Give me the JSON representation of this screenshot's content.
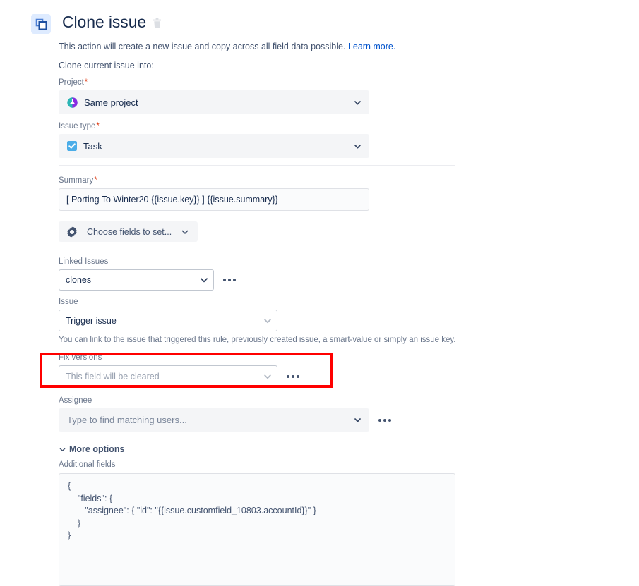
{
  "header": {
    "icon": "clone-issue-icon",
    "title": "Clone issue",
    "delete_icon": "trash-icon"
  },
  "description": {
    "text": "This action will create a new issue and copy across all field data possible.",
    "link_label": "Learn more.",
    "subtitle": "Clone current issue into:"
  },
  "fields": {
    "project": {
      "label": "Project",
      "required": "*",
      "value": "Same project",
      "icon": "project-avatar-icon",
      "chevron": "chevron-down-icon"
    },
    "issue_type": {
      "label": "Issue type",
      "required": "*",
      "value": "Task",
      "icon": "task-checkbox-icon",
      "chevron": "chevron-down-icon"
    },
    "summary": {
      "label": "Summary",
      "required": "*",
      "value": "[ Porting To Winter20 {{issue.key}} ] {{issue.summary}}"
    },
    "choose_fields": {
      "label": "Choose fields to set...",
      "icon": "gear-icon",
      "chevron": "chevron-down-icon"
    },
    "linked_issues": {
      "label": "Linked Issues",
      "value": "clones",
      "chevron": "chevron-down-icon",
      "menu_icon": "more-options-icon"
    },
    "issue": {
      "label": "Issue",
      "value": "Trigger issue",
      "chevron": "chevron-down-icon",
      "helper": "You can link to the issue that triggered this rule, previously created issue, a smart-value or simply an issue key."
    },
    "fix_versions": {
      "label": "Fix versions",
      "placeholder": "This field will be cleared",
      "chevron": "chevron-down-icon",
      "menu_icon": "more-options-icon",
      "highlighted": true,
      "highlight_color": "#ff0000"
    },
    "assignee": {
      "label": "Assignee",
      "placeholder": "Type to find matching users...",
      "chevron": "chevron-down-icon",
      "menu_icon": "more-options-icon"
    }
  },
  "more_options": {
    "label": "More options",
    "chevron": "chevron-down-icon"
  },
  "additional_fields": {
    "label": "Additional fields",
    "code": "{\n    \"fields\": {\n       \"assignee\": { \"id\": \"{{issue.customfield_10803.accountId}}\" }\n    }\n}"
  },
  "colors": {
    "accent": "#0052cc",
    "required": "#de350b",
    "annotation": "#ff0000",
    "icon_bg": "#deebff",
    "text": "#172b4d",
    "muted": "#6b778c"
  }
}
